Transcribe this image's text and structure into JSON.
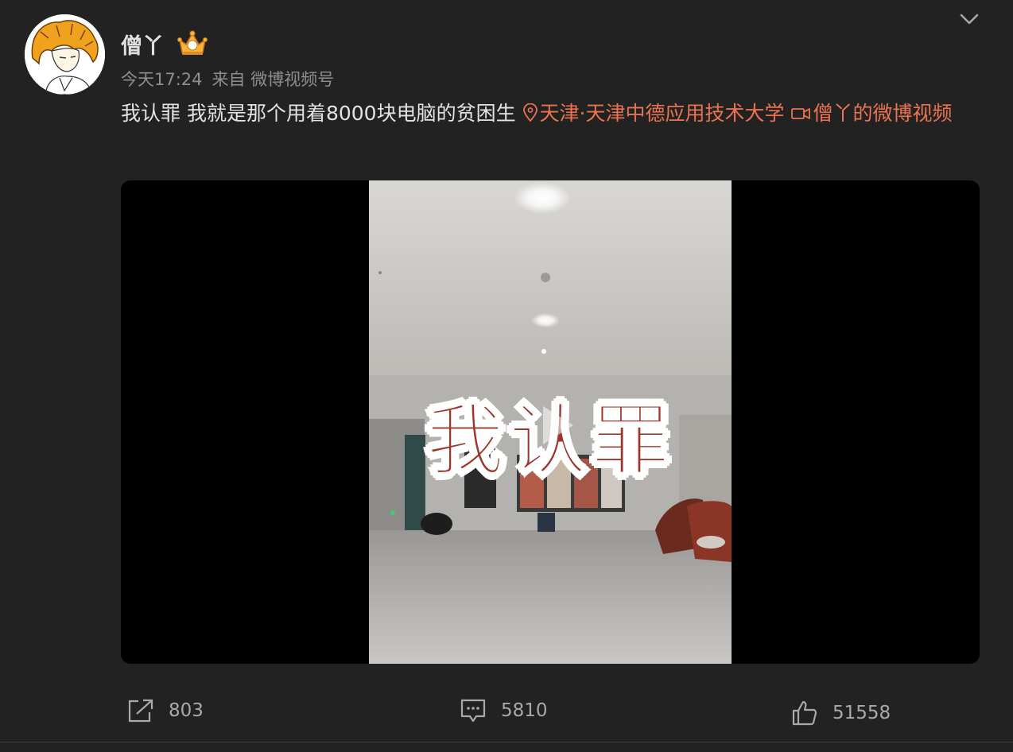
{
  "user": {
    "name": "僧丫"
  },
  "post": {
    "time": "今天17:24",
    "source": "来自 微博视频号",
    "text": "我认罪 我就是那个用着8000块电脑的贫困生 ",
    "location": "天津·天津中德应用技术大学",
    "video_link": "僧丫的微博视频"
  },
  "video": {
    "caption": "我认罪"
  },
  "actions": {
    "repost": "803",
    "comment": "5810",
    "like": "51558"
  },
  "colors": {
    "background": "#222223",
    "link": "#eb7350",
    "muted": "#8e8e8f"
  }
}
